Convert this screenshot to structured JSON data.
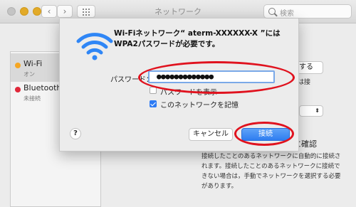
{
  "window": {
    "title": "ネットワーク",
    "back_glyph": "‹",
    "forward_glyph": "›",
    "search_placeholder": "検索"
  },
  "sidebar": {
    "items": [
      {
        "name": "Wi-Fi",
        "status": "オン",
        "dot_color": "#f5a623",
        "selected": true
      },
      {
        "name": "Bluetooth P",
        "status": "未接続",
        "dot_color": "#e0283a",
        "selected": false
      }
    ]
  },
  "background_panel": {
    "button_fragment": "にする",
    "text_fragment": "クには接",
    "select_glyph": "⬍",
    "checkbox_fragment": "に確認",
    "help_text": "接続したことのあるネットワークに自動的に接続されます。接続したことのあるネットワークに接続できない場合は，手動でネットワークを選択する必要があります。"
  },
  "dialog": {
    "title": "Wi-Fiネットワーク“ aterm-XXXXXX-X ”にはWPA2パスワードが必要です。",
    "password_label": "パスワード：",
    "password_value": "●●●●●●●●●●●●●",
    "show_password_label": "パスワードを表示",
    "remember_label": "このネットワークを記憶",
    "remember_checked": true,
    "help_label": "?",
    "cancel_label": "キャンセル",
    "connect_label": "接続"
  },
  "colors": {
    "accent_blue": "#2f7df0",
    "annotation_red": "#e0121e",
    "wifi_blue": "#2f86f6"
  }
}
